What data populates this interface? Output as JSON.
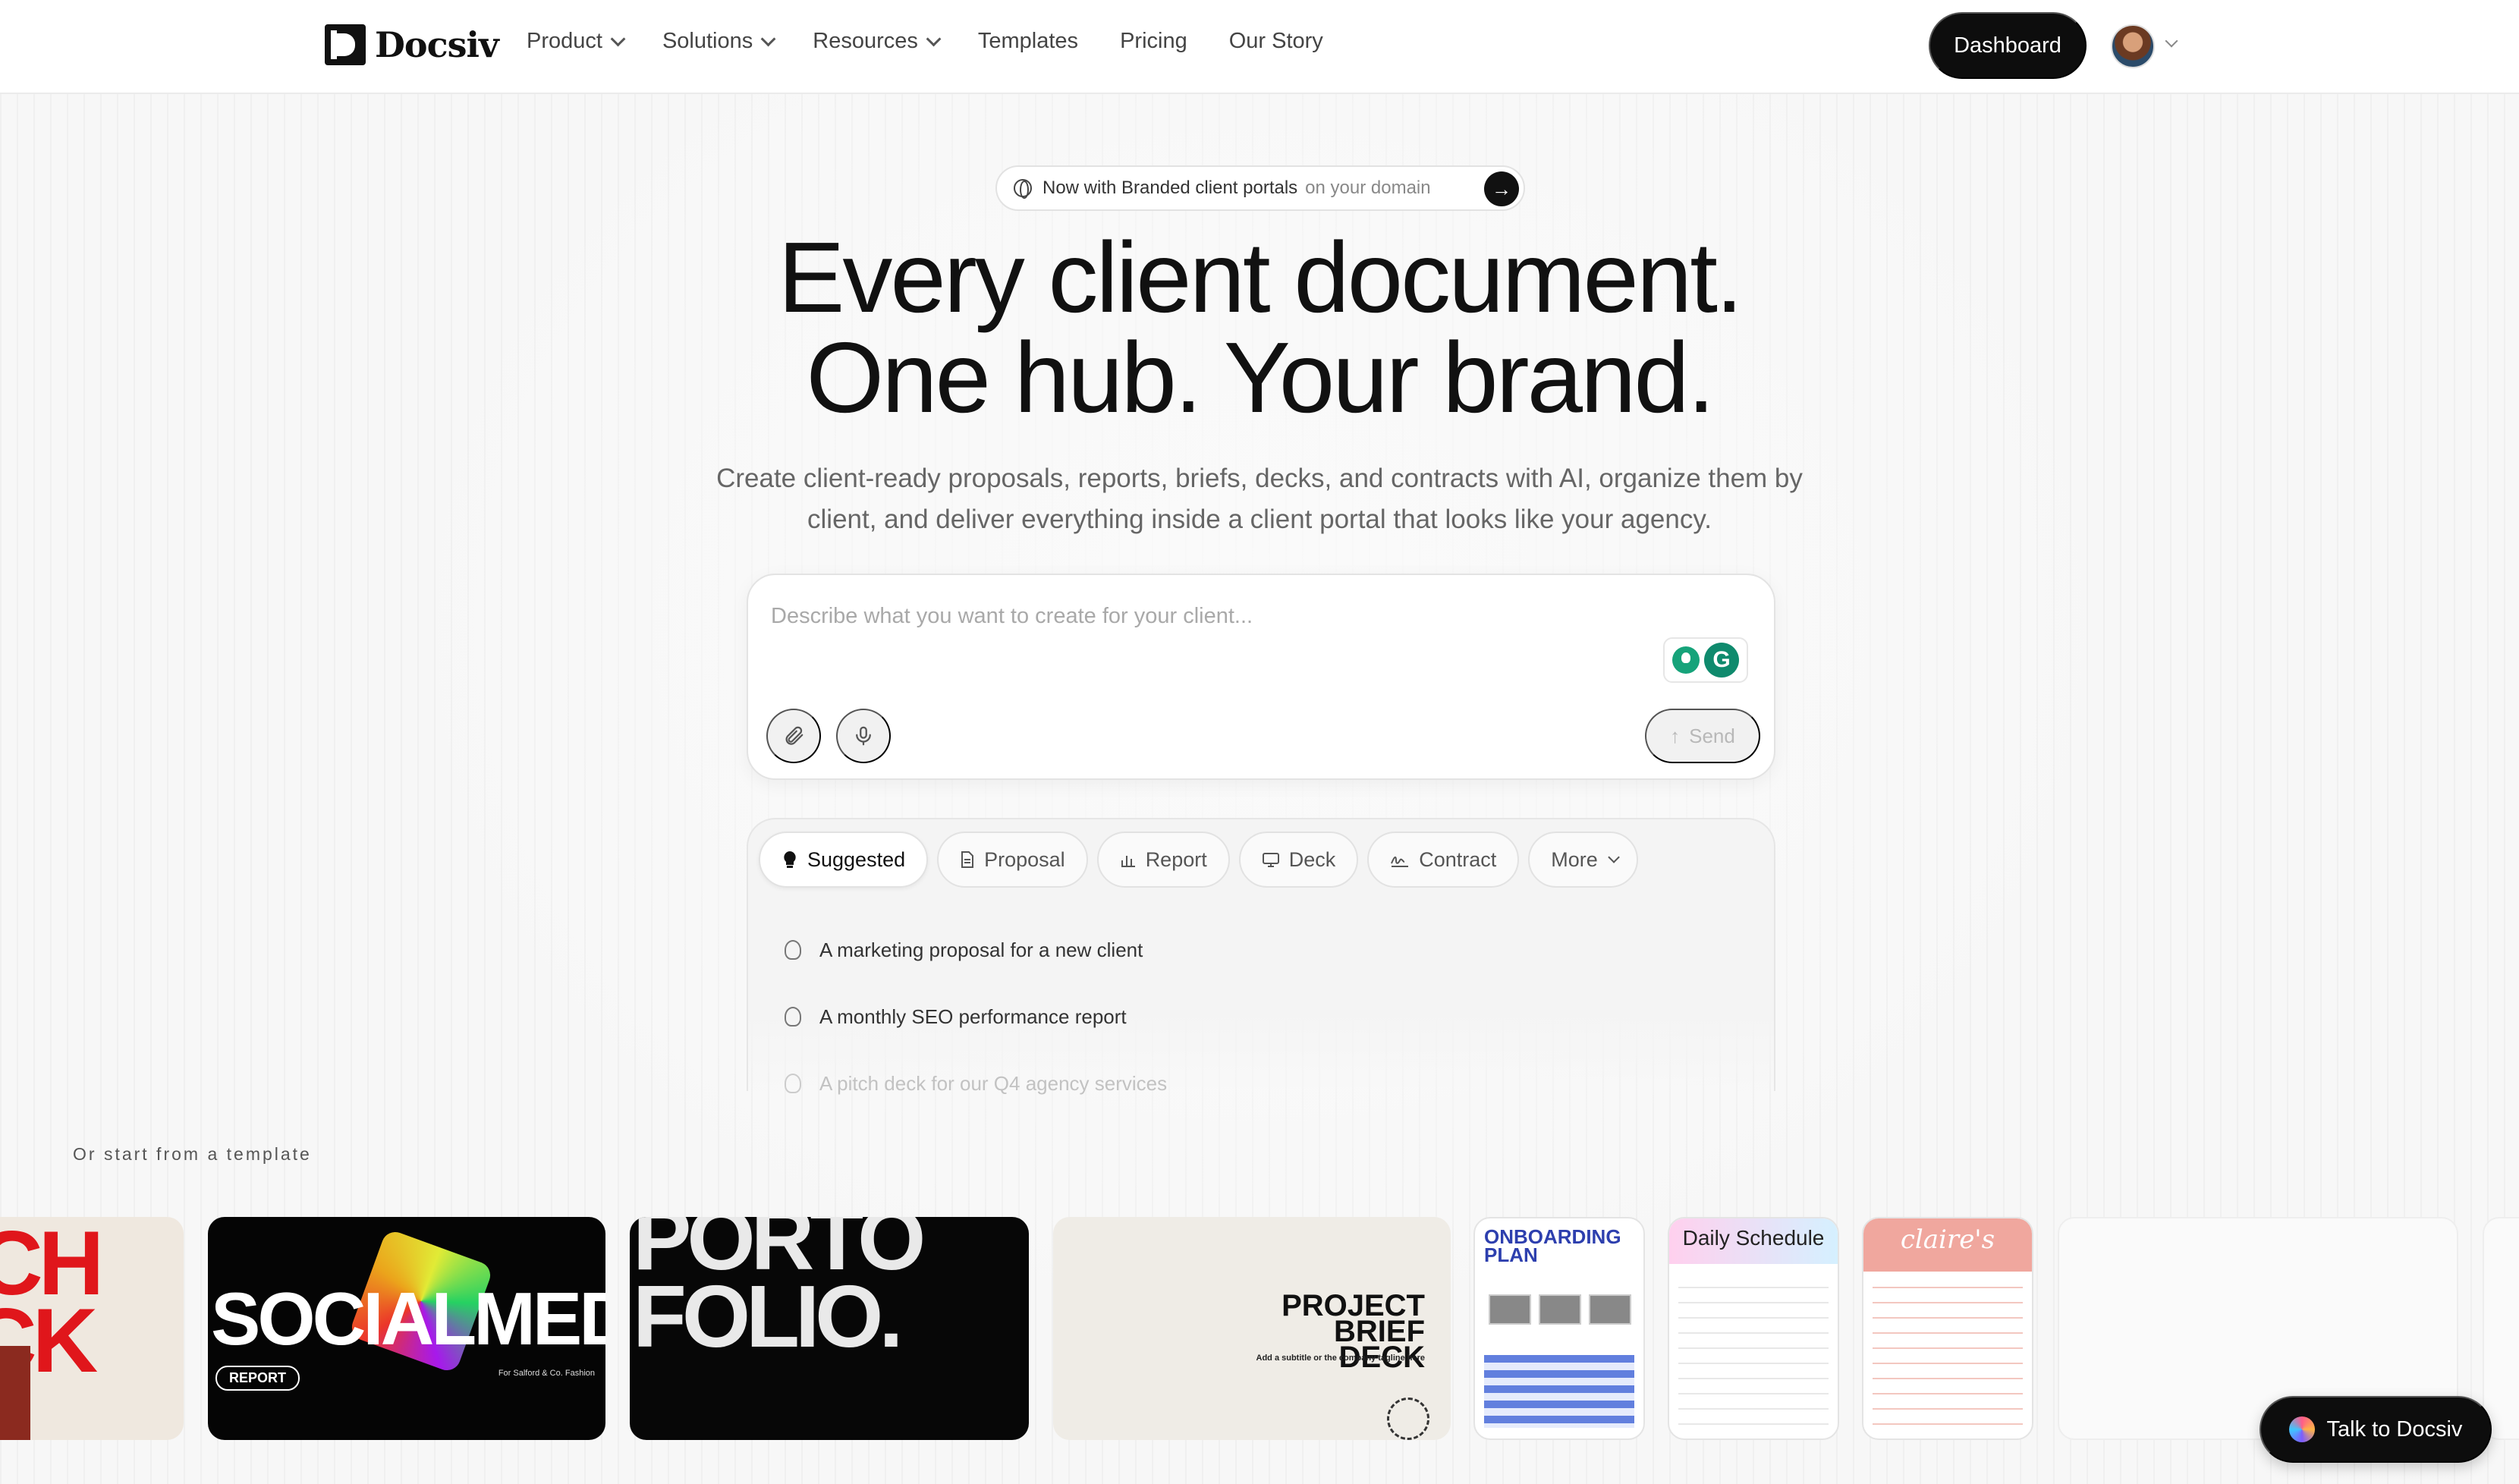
{
  "nav": {
    "brand": "Docsiv",
    "links": [
      {
        "label": "Product",
        "dropdown": true
      },
      {
        "label": "Solutions",
        "dropdown": true
      },
      {
        "label": "Resources",
        "dropdown": true
      },
      {
        "label": "Templates",
        "dropdown": false
      },
      {
        "label": "Pricing",
        "dropdown": false
      },
      {
        "label": "Our Story",
        "dropdown": false
      }
    ],
    "dashboard_label": "Dashboard"
  },
  "hero": {
    "badge_main": "Now with Branded client portals",
    "badge_sub": "on your domain",
    "headline_line1": "Every client document.",
    "headline_line2": "One hub. Your brand.",
    "subhead": "Create client-ready proposals, reports, briefs, decks, and contracts with AI, organize them by client, and deliver everything inside a client portal that looks like your agency."
  },
  "prompt": {
    "placeholder": "Describe what you want to create for your client...",
    "value": "",
    "send_label": "Send"
  },
  "suggestions": {
    "tabs": [
      {
        "label": "Suggested",
        "icon": "bulb-icon",
        "active": true
      },
      {
        "label": "Proposal",
        "icon": "document-icon",
        "active": false
      },
      {
        "label": "Report",
        "icon": "bar-chart-icon",
        "active": false
      },
      {
        "label": "Deck",
        "icon": "presentation-icon",
        "active": false
      },
      {
        "label": "Contract",
        "icon": "signature-icon",
        "active": false
      },
      {
        "label": "More",
        "icon": "chevron-down-icon",
        "active": false
      }
    ],
    "items": [
      "A marketing proposal for a new client",
      "A monthly SEO performance report",
      "A pitch deck for our Q4 agency services"
    ]
  },
  "templates": {
    "label": "Or start from a template",
    "cards": {
      "pitch_deck": {
        "top": "CH",
        "bottom": "CK"
      },
      "social_media": {
        "title": "SOCIALMEDIA",
        "tag": "REPORT",
        "caption": "For Salford & Co. Fashion"
      },
      "portfolio": {
        "line1": "PORTO",
        "line2": "FOLIO."
      },
      "project_brief": {
        "line1": "PROJECT",
        "line2": "BRIEF DECK",
        "subtitle": "Add a subtitle or the company tagline here"
      },
      "onboarding": {
        "line1": "ONBOARDING",
        "line2": "PLAN"
      },
      "daily_schedule": {
        "title": "Daily Schedule"
      },
      "claire": {
        "title": "claire's"
      }
    }
  },
  "talk": {
    "label": "Talk to Docsiv"
  },
  "colors": {
    "primary": "#0d0d0d",
    "background": "#f7f7f7",
    "accent_red": "#e0161b"
  }
}
